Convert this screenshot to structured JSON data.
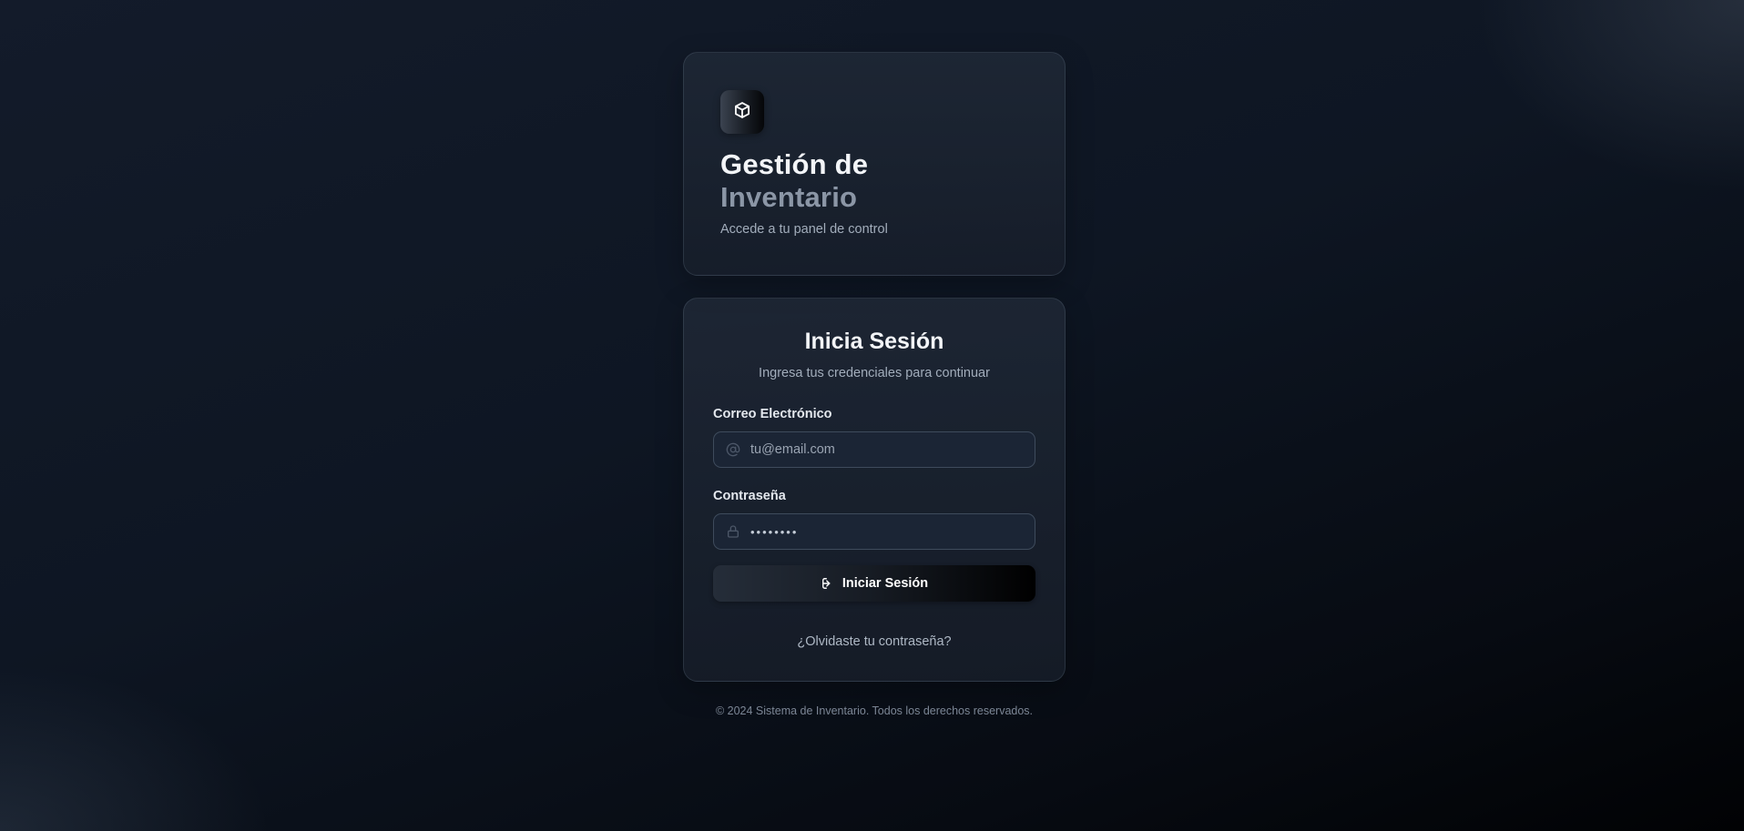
{
  "brand": {
    "logo_icon": "box-icon",
    "title_line1": "Gestión de",
    "title_line2": "Inventario",
    "subtitle": "Accede a tu panel de control"
  },
  "login": {
    "title": "Inicia Sesión",
    "subtitle": "Ingresa tus credenciales para continuar",
    "email": {
      "label": "Correo Electrónico",
      "placeholder": "tu@email.com",
      "value": "",
      "icon": "at-sign-icon"
    },
    "password": {
      "label": "Contraseña",
      "value": "••••••••",
      "icon": "lock-icon"
    },
    "submit": {
      "label": "Iniciar Sesión",
      "icon": "log-in-icon"
    },
    "forgot_link": "¿Olvidaste tu contraseña?"
  },
  "footer": {
    "text": "© 2024 Sistema de Inventario. Todos los derechos reservados."
  },
  "colors": {
    "background_start": "#131b2a",
    "background_end": "#010204",
    "card_bg": "#1f2836",
    "accent_text": "#8b96a6",
    "button_gradient_end": "#000000"
  }
}
